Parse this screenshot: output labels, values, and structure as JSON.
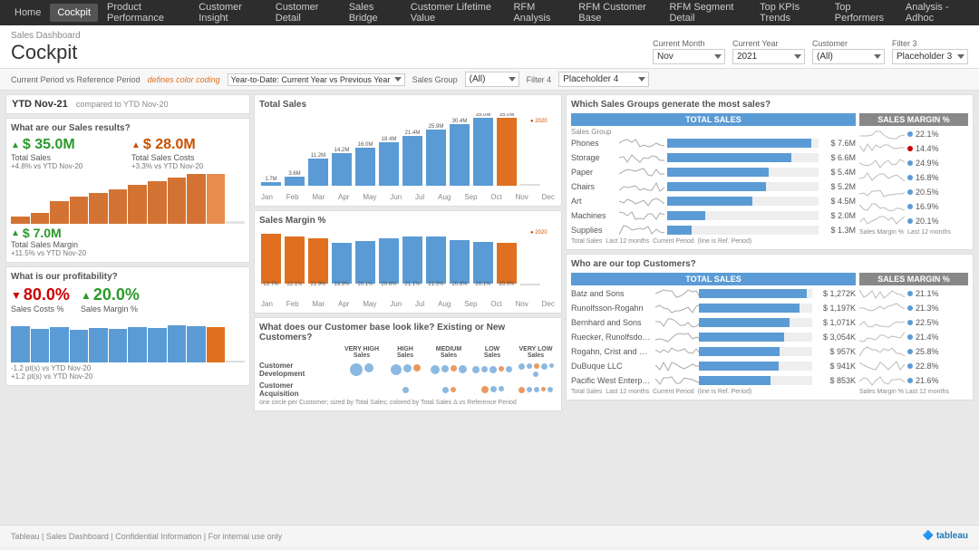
{
  "nav": {
    "items": [
      {
        "label": "Home",
        "active": false
      },
      {
        "label": "Cockpit",
        "active": true
      },
      {
        "label": "Product Performance",
        "active": false
      },
      {
        "label": "Customer Insight",
        "active": false
      },
      {
        "label": "Customer Detail",
        "active": false
      },
      {
        "label": "Sales Bridge",
        "active": false
      },
      {
        "label": "Customer Lifetime Value",
        "active": false
      },
      {
        "label": "RFM Analysis",
        "active": false
      },
      {
        "label": "RFM Customer Base",
        "active": false
      },
      {
        "label": "RFM Segment Detail",
        "active": false
      },
      {
        "label": "Top KPIs Trends",
        "active": false
      },
      {
        "label": "Top Performers",
        "active": false
      },
      {
        "label": "Analysis - Adhoc",
        "active": false
      }
    ]
  },
  "header": {
    "breadcrumb": "Sales Dashboard",
    "title": "Cockpit"
  },
  "filters": {
    "current_month_label": "Current Month",
    "current_month_value": "Nov",
    "current_year_label": "Current Year",
    "current_year_value": "2021",
    "customer_label": "Customer",
    "customer_value": "(All)",
    "filter3_label": "Filter 3",
    "filter3_value": "Placeholder 3",
    "current_period_label": "Current Period vs Reference Period",
    "color_coding_label": "defines color coding",
    "current_period_value": "Year-to-Date: Current Year vs Previous Year",
    "sales_group_label": "Sales Group",
    "sales_group_value": "(All)",
    "filter4_label": "Filter 4",
    "filter4_value": "Placeholder 4"
  },
  "ytd": {
    "header": "YTD Nov-21",
    "compared": "compared to YTD Nov-20",
    "section1_title": "What are our Sales results?",
    "total_sales_value": "$ 35.0M",
    "total_sales_label": "Total Sales",
    "total_sales_change": "+4.8% vs YTD Nov-20",
    "total_costs_value": "$ 28.0M",
    "total_costs_label": "Total Sales Costs",
    "total_costs_change": "+3.3% vs YTD Nov-20",
    "total_margin_value": "$ 7.0M",
    "total_margin_label": "Total Sales Margin",
    "total_margin_change": "+11.5% vs YTD Nov-20"
  },
  "profitability": {
    "title": "What is our profitability?",
    "costs_pct": "80.0%",
    "costs_pct_label": "Sales Costs %",
    "margin_pct": "20.0%",
    "margin_pct_label": "Sales Margin %",
    "costs_change": "-1.2 pt(s) vs YTD Nov-20",
    "margin_change": "+1.2 pt(s) vs YTD Nov-20"
  },
  "total_sales": {
    "title": "Total Sales",
    "months": [
      "Jan",
      "Feb",
      "Mar",
      "Apr",
      "May",
      "Jun",
      "Jul",
      "Aug",
      "Sep",
      "Oct",
      "Nov",
      "Dec"
    ],
    "values": [
      1.7,
      3.6,
      11.2,
      14.2,
      16.0,
      18.4,
      21.4,
      25.9,
      30.4,
      35.0,
      35.0,
      null
    ],
    "bar_values": [
      1.7,
      3.6,
      11.2,
      14.2,
      16.0,
      18.4,
      21.4,
      25.9,
      30.4,
      35.0,
      35.0,
      0
    ],
    "max": 40
  },
  "sales_margin": {
    "title": "Sales Margin %",
    "months": [
      "Jan",
      "Feb",
      "Mar",
      "Apr",
      "May",
      "Jun",
      "Jul",
      "Aug",
      "Sep",
      "Oct",
      "Nov",
      "Dec"
    ],
    "values": [
      22.7,
      22.1,
      21.9,
      19.9,
      20.1,
      20.6,
      21.1,
      21.5,
      20.8,
      20.1,
      20.0,
      null
    ]
  },
  "customer_base": {
    "title": "What does our Customer base look like? Existing or New Customers?",
    "categories": [
      {
        "label": "VERY HIGH Sales",
        "bubbles": 3
      },
      {
        "label": "HIGH Sales",
        "bubbles": 5
      },
      {
        "label": "MEDIUM Sales",
        "bubbles": 8
      },
      {
        "label": "LOW Sales",
        "bubbles": 14
      },
      {
        "label": "VERY LOW Sales",
        "bubbles": 20
      }
    ],
    "rows": [
      "Customer Development",
      "Customer Acquisition"
    ],
    "note": "one circle per Customer; sized by Total Sales; colored by Total Sales Δ vs Reference Period"
  },
  "sales_groups": {
    "title": "Which Sales Groups generate the most sales?",
    "header_total": "TOTAL SALES",
    "header_margin": "SALES MARGIN %",
    "groups": [
      {
        "label": "Phones",
        "total": "$ 7.6M",
        "total_pct": 95,
        "margin": "22.1%",
        "margin_dot": "blue"
      },
      {
        "label": "Storage",
        "total": "$ 6.6M",
        "total_pct": 82,
        "margin": "14.4%",
        "margin_dot": "red"
      },
      {
        "label": "Paper",
        "total": "$ 5.4M",
        "total_pct": 67,
        "margin": "24.9%",
        "margin_dot": "blue"
      },
      {
        "label": "Chairs",
        "total": "$ 5.2M",
        "total_pct": 65,
        "margin": "16.8%",
        "margin_dot": "blue"
      },
      {
        "label": "Art",
        "total": "$ 4.5M",
        "total_pct": 56,
        "margin": "20.5%",
        "margin_dot": "blue"
      },
      {
        "label": "Machines",
        "total": "$ 2.0M",
        "total_pct": 25,
        "margin": "16.9%",
        "margin_dot": "blue"
      },
      {
        "label": "Supplies",
        "total": "$ 1.3M",
        "total_pct": 16,
        "margin": "20.1%",
        "margin_dot": "blue"
      }
    ],
    "legend": [
      "Total Sales",
      "Last 12 months",
      "Current Period",
      "(line is Ref. Period)"
    ],
    "legend2": [
      "Sales Margin %",
      "Last 12 months",
      "Current Period",
      "(line is Ref. Period)"
    ]
  },
  "top_customers": {
    "title": "Who are our top Customers?",
    "header_total": "TOTAL SALES",
    "header_margin": "SALES MARGIN %",
    "customers": [
      {
        "label": "Batz and Sons",
        "total": "$ 1,272K",
        "total_pct": 95,
        "margin": "21.1%",
        "margin_dot": "blue"
      },
      {
        "label": "Runolfsson-Rogahn",
        "total": "$ 1,197K",
        "total_pct": 89,
        "margin": "21.3%",
        "margin_dot": "blue"
      },
      {
        "label": "Bernhard and Sons",
        "total": "$ 1,071K",
        "total_pct": 80,
        "margin": "22.5%",
        "margin_dot": "blue"
      },
      {
        "label": "Ruecker, Runolfsdottir and ...",
        "total": "$ 3,054K",
        "total_pct": 75,
        "margin": "21.4%",
        "margin_dot": "blue"
      },
      {
        "label": "Rogahn, Crist and Gulgowski",
        "total": "$ 957K",
        "total_pct": 71,
        "margin": "25.8%",
        "margin_dot": "blue"
      },
      {
        "label": "DuBuque LLC",
        "total": "$ 941K",
        "total_pct": 70,
        "margin": "22.8%",
        "margin_dot": "blue"
      },
      {
        "label": "Pacific West Enterprises",
        "total": "$ 853K",
        "total_pct": 63,
        "margin": "21.6%",
        "margin_dot": "blue"
      }
    ],
    "legend": [
      "Total Sales",
      "Last 12 months",
      "Current Period",
      "(line is Ref. Period)"
    ],
    "legend2": [
      "Sales Margin %",
      "Last 12 months",
      "Current Period",
      "(line is Ref. Period)"
    ]
  },
  "footer": {
    "text": "Tableau | Sales Dashboard | Confidential Information | For internal use only",
    "logo": "🔷 tableau"
  }
}
